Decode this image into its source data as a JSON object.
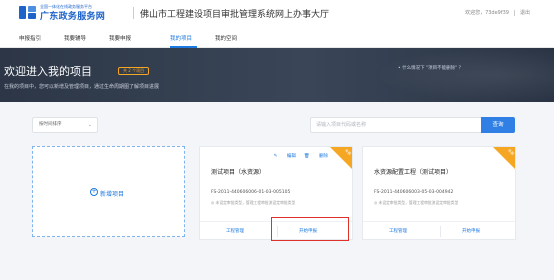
{
  "header": {
    "brand_sub": "全国一体化在线政务服务平台",
    "brand_main": "广东政务服务网",
    "site_title": "佛山市工程建设项目审批管理系统网上办事大厅",
    "welcome": "欢迎您，73de9f39",
    "logout": "退出",
    "logo_icon": "guangdong-logo-icon",
    "brand_color": "#1e63c9"
  },
  "nav": {
    "items": [
      {
        "label": "申报指引"
      },
      {
        "label": "我要辅导"
      },
      {
        "label": "我要申报"
      },
      {
        "label": "我的项目"
      },
      {
        "label": "我的空间"
      }
    ],
    "active": "我的项目",
    "accent": "#1e7ae0"
  },
  "banner": {
    "title": "欢迎进入我的项目",
    "badge": "共 2 个项目",
    "desc": "在我的项目中，您可以新增及管理项目，通过生命周期图了解项目进展",
    "help": "• 什么情况下 \"项目不能删除\" ？"
  },
  "filter": {
    "sort_value": "按时间排序",
    "search_placeholder": "请输入项目代码或名称",
    "search_button": "查询"
  },
  "new_project": {
    "label": "新增项目"
  },
  "cards": [
    {
      "corner": "未报",
      "edit": "编辑",
      "delete": "删除",
      "title": "测试项目（水资源）",
      "code": "FS-2011-440606006-01-03-005105",
      "note": "◎ 未设定审批类型，管理工程审批流设定审批类型",
      "left_btn": "工程管理",
      "right_btn": "开始申报"
    },
    {
      "corner": "未报",
      "title": "水资源配置工程（测试项目）",
      "code": "FS-2011-440606003-05-03-004942",
      "note": "◎ 未设定审批类型，管理工程审批流设定审批类型",
      "left_btn": "工程管理",
      "right_btn": "开始申报"
    }
  ]
}
